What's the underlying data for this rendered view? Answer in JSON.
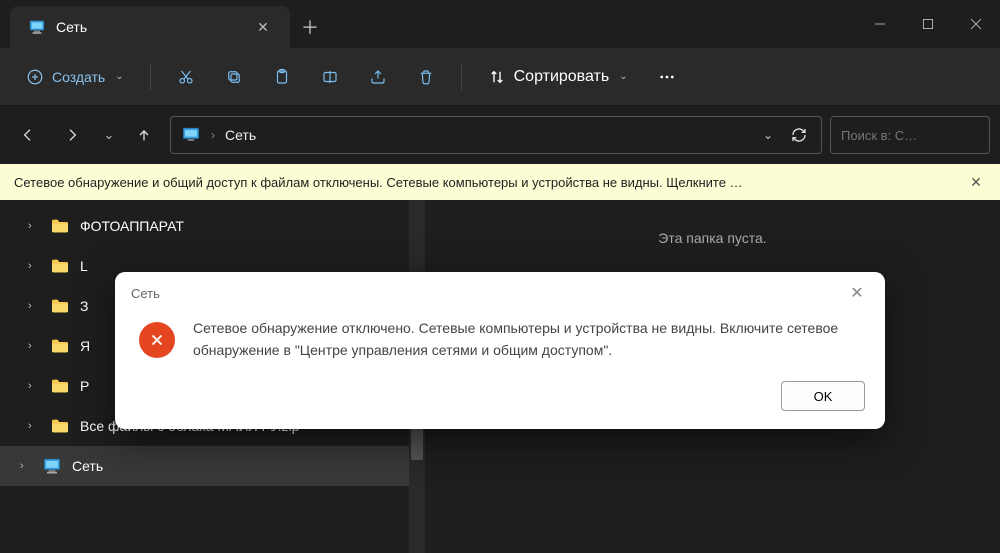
{
  "tab": {
    "title": "Сеть"
  },
  "toolbar": {
    "create": "Создать",
    "sort": "Сортировать"
  },
  "address": {
    "crumb": "Сеть"
  },
  "search": {
    "placeholder": "Поиск в: С…"
  },
  "infobar": {
    "text": "Сетевое обнаружение и общий доступ к файлам отключены. Сетевые компьютеры и устройства не видны. Щелкните …"
  },
  "tree": {
    "items": [
      {
        "label": "ФОТОАППАРАТ",
        "kind": "folder"
      },
      {
        "label": "L",
        "kind": "folder"
      },
      {
        "label": "З",
        "kind": "folder"
      },
      {
        "label": "Я",
        "kind": "folder"
      },
      {
        "label": "Р",
        "kind": "folder"
      },
      {
        "label": "Все файлы с облака МАЙЛ РУ.zip",
        "kind": "folder"
      }
    ],
    "network": "Сеть"
  },
  "main": {
    "empty": "Эта папка пуста."
  },
  "dialog": {
    "title": "Сеть",
    "message": "Сетевое обнаружение отключено. Сетевые компьютеры и устройства не видны. Включите сетевое обнаружение в \"Центре управления сетями и общим доступом\".",
    "ok": "OK"
  }
}
